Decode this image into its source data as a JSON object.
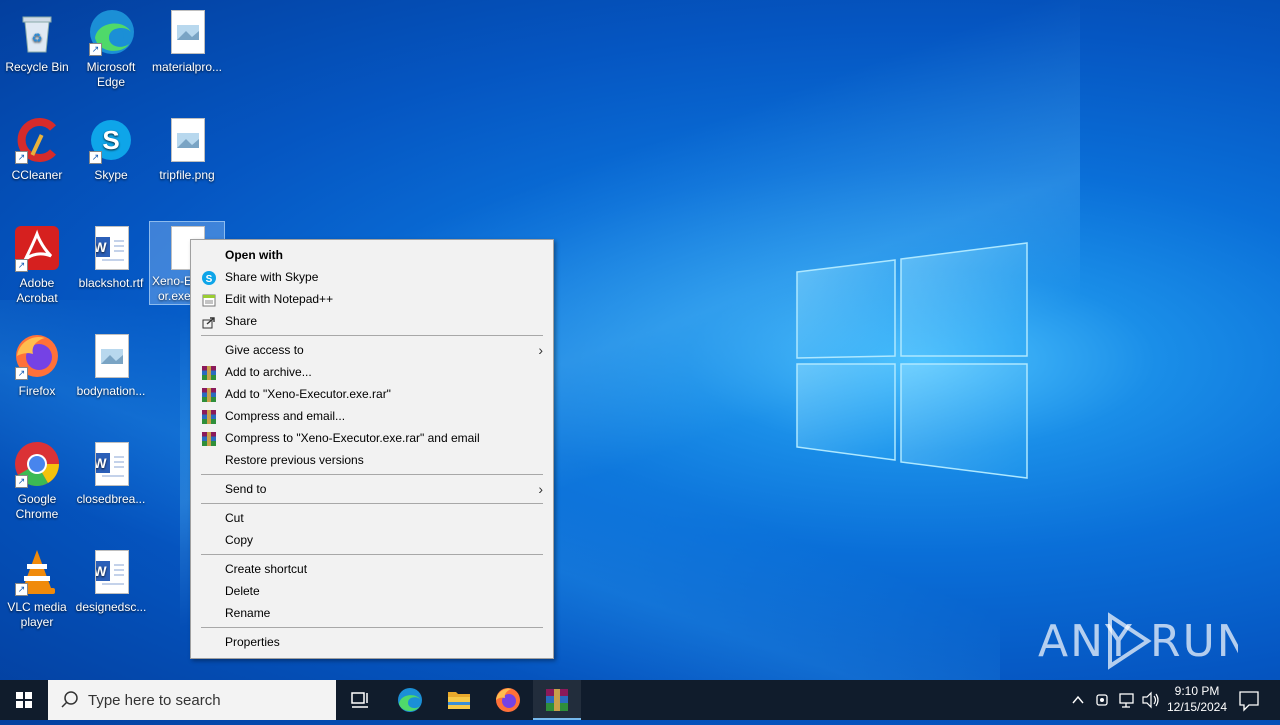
{
  "desktop": {
    "icons": [
      {
        "label": "Recycle Bin"
      },
      {
        "label": "Microsoft Edge"
      },
      {
        "label": "materialpro..."
      },
      {
        "label": "CCleaner"
      },
      {
        "label": "Skype"
      },
      {
        "label": "tripfile.png"
      },
      {
        "label": "Adobe Acrobat"
      },
      {
        "label": "blackshot.rtf"
      },
      {
        "label": "Xeno-Executor.exe"
      },
      {
        "label": "Firefox"
      },
      {
        "label": "bodynation..."
      },
      {
        "label": "Google Chrome"
      },
      {
        "label": "closedbrea..."
      },
      {
        "label": "VLC media player"
      },
      {
        "label": "designedsc..."
      }
    ],
    "selected_icon_label_line1": "Xeno-E",
    "selected_icon_label_line2": "or.exe"
  },
  "context_menu": {
    "items": [
      {
        "label": "Open with",
        "icon": "none"
      },
      {
        "label": "Share with Skype",
        "icon": "skype-icon"
      },
      {
        "label": "Edit with Notepad++",
        "icon": "notepadpp-icon"
      },
      {
        "label": "Share",
        "icon": "share-icon"
      },
      {
        "label": "Give access to",
        "icon": "none"
      },
      {
        "label": "Add to archive...",
        "icon": "winrar-icon"
      },
      {
        "label": "Add to \"Xeno-Executor.exe.rar\"",
        "icon": "winrar-icon"
      },
      {
        "label": "Compress and email...",
        "icon": "winrar-icon"
      },
      {
        "label": "Compress to \"Xeno-Executor.exe.rar\" and email",
        "icon": "winrar-icon"
      },
      {
        "label": "Restore previous versions",
        "icon": "none"
      },
      {
        "label": "Send to",
        "icon": "none"
      },
      {
        "label": "Cut",
        "icon": "none"
      },
      {
        "label": "Copy",
        "icon": "none"
      },
      {
        "label": "Create shortcut",
        "icon": "none"
      },
      {
        "label": "Delete",
        "icon": "none"
      },
      {
        "label": "Rename",
        "icon": "none"
      },
      {
        "label": "Properties",
        "icon": "none"
      }
    ],
    "submenu_arrow": "›"
  },
  "taskbar": {
    "search_placeholder": "Type here to search",
    "apps": [
      "task-view-icon",
      "edge-icon",
      "file-explorer-icon",
      "firefox-icon",
      "winrar-icon"
    ],
    "clock_time": "9:10 PM",
    "clock_date": "12/15/2024"
  },
  "watermark": {
    "text": "ANY RUN"
  },
  "colors": {
    "desktop_blue": "#0a6fd8",
    "taskbar": "#101c2c",
    "menu_bg": "#f2f2f2",
    "selection": "#76b9ed"
  }
}
